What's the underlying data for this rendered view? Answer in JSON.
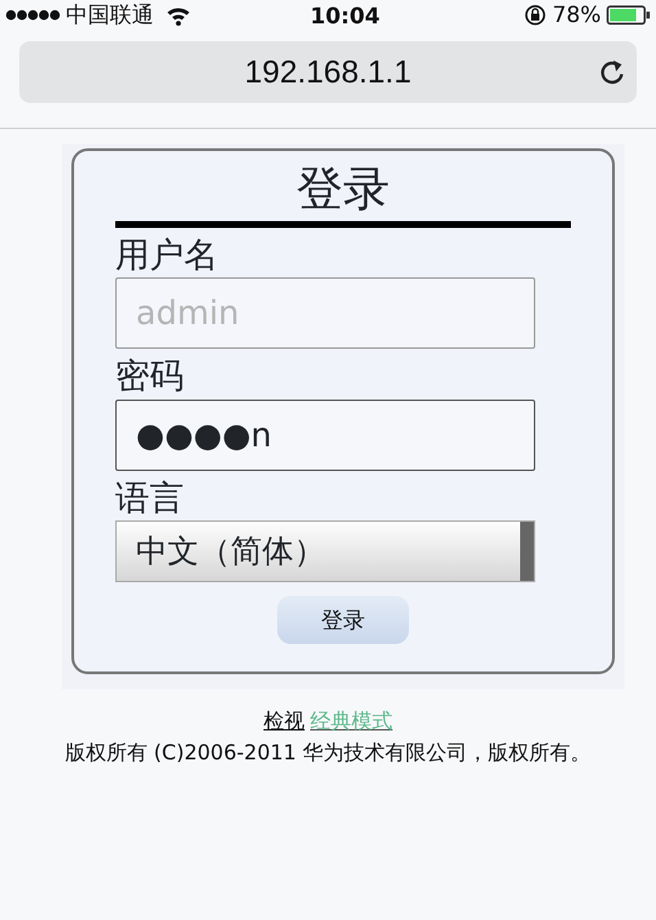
{
  "status_bar": {
    "carrier": "中国联通",
    "time": "10:04",
    "battery": "78%"
  },
  "address_bar": {
    "url": "192.168.1.1"
  },
  "login": {
    "title": "登录",
    "fields": [
      {
        "kind": "text",
        "label": "用户名",
        "placeholder": "admin"
      },
      {
        "kind": "password",
        "label": "密码",
        "value": "●●●●n"
      },
      {
        "kind": "select",
        "label": "语言",
        "value": "中文（简体）"
      }
    ],
    "button": "登录"
  },
  "footer": {
    "prefix": "检视",
    "link": "经典模式",
    "copyright": "版权所有 (C)2006-2011 华为技术有限公司，版权所有。"
  }
}
